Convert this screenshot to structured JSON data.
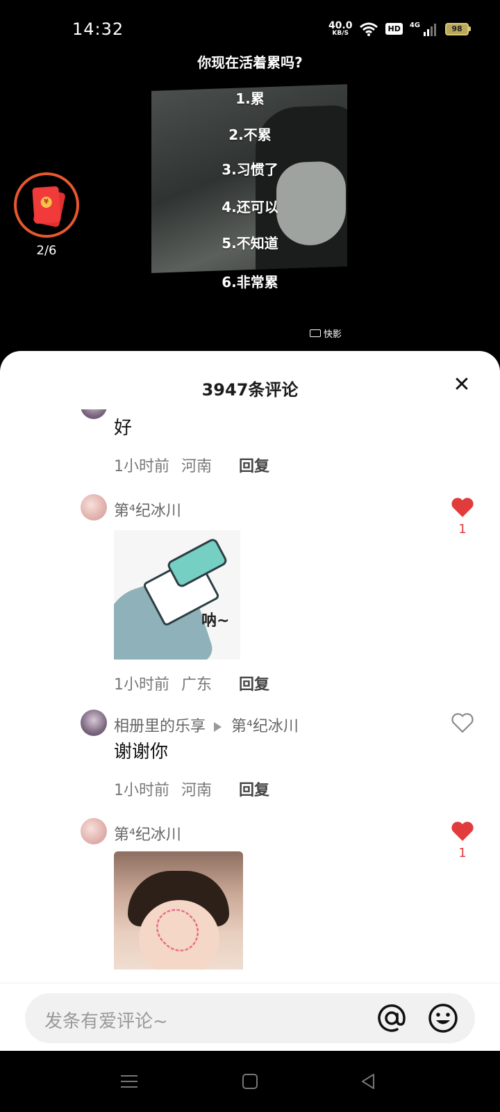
{
  "status_bar": {
    "time": "14:32",
    "net_speed": "40.0",
    "net_unit": "KB/S",
    "hd": "HD",
    "signal_label": "4G",
    "battery": "98"
  },
  "video": {
    "question": "你现在活着累吗?",
    "options": [
      "1.累",
      "2.不累",
      "3.习惯了",
      "4.还可以",
      "5.不知道",
      "6.非常累"
    ],
    "watermark": "快影"
  },
  "red_packet": {
    "count": "2/6",
    "coin_symbol": "¥"
  },
  "comments_panel": {
    "title": "3947条评论",
    "close_symbol": "✕"
  },
  "comments": [
    {
      "text": "好",
      "time": "1小时前",
      "location": "河南",
      "reply_label": "回复"
    },
    {
      "user": "第⁴纪冰川",
      "sticker_text": "呐~",
      "time": "1小时前",
      "location": "广东",
      "reply_label": "回复",
      "likes": "1",
      "liked": true
    },
    {
      "user": "相册里的乐享",
      "reply_to": "第⁴纪冰川",
      "text": "谢谢你",
      "time": "1小时前",
      "location": "河南",
      "reply_label": "回复",
      "liked": false
    },
    {
      "user": "第⁴纪冰川",
      "likes": "1",
      "liked": true
    }
  ],
  "input": {
    "placeholder": "发条有爱评论~"
  },
  "colors": {
    "like_red": "#e23b3b",
    "red_packet_ring": "#e7582d"
  }
}
